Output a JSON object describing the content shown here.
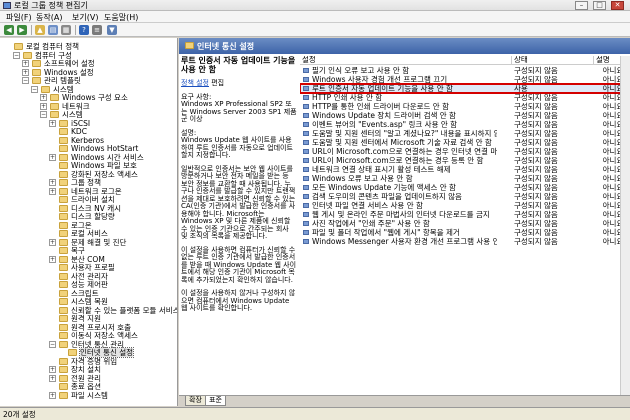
{
  "window": {
    "title": "로컬 그룹 정책 편집기",
    "controls": [
      "–",
      "□",
      "✕"
    ]
  },
  "menu": [
    "파일(F)",
    "동작(A)",
    "보기(V)",
    "도움말(H)"
  ],
  "toolbar": {
    "icons": [
      "back-arrow-icon",
      "forward-arrow-icon",
      "up-folder-icon",
      "show-hide-tree-icon",
      "export-list-icon",
      "help-icon",
      "properties-icon",
      "filter-icon"
    ]
  },
  "tree": [
    {
      "label": "로컬 컴퓨터 정책",
      "level": 0,
      "expander": ""
    },
    {
      "label": "컴퓨터 구성",
      "level": 1,
      "expander": "−"
    },
    {
      "label": "소프트웨어 설정",
      "level": 2,
      "expander": "+"
    },
    {
      "label": "Windows 설정",
      "level": 2,
      "expander": "+"
    },
    {
      "label": "관리 템플릿",
      "level": 2,
      "expander": "−"
    },
    {
      "label": "시스템",
      "level": 3,
      "expander": "−"
    },
    {
      "label": "Windows 구성 요소",
      "level": 4,
      "expander": "+"
    },
    {
      "label": "네트워크",
      "level": 4,
      "expander": "+"
    },
    {
      "label": "시스템",
      "level": 4,
      "expander": "−"
    },
    {
      "label": "iSCSI",
      "level": 5,
      "expander": "+"
    },
    {
      "label": "KDC",
      "level": 5,
      "expander": ""
    },
    {
      "label": "Kerberos",
      "level": 5,
      "expander": ""
    },
    {
      "label": "Windows HotStart",
      "level": 5,
      "expander": ""
    },
    {
      "label": "Windows 시간 서비스",
      "level": 5,
      "expander": "+"
    },
    {
      "label": "Windows 파일 보호",
      "level": 5,
      "expander": ""
    },
    {
      "label": "강화된 저장소 액세스",
      "level": 5,
      "expander": ""
    },
    {
      "label": "그룹 정책",
      "level": 5,
      "expander": "+"
    },
    {
      "label": "네트워크 로그온",
      "level": 5,
      "expander": "+"
    },
    {
      "label": "드라이버 설치",
      "level": 5,
      "expander": ""
    },
    {
      "label": "디스크 NV 캐시",
      "level": 5,
      "expander": ""
    },
    {
      "label": "디스크 할당량",
      "level": 5,
      "expander": ""
    },
    {
      "label": "로그온",
      "level": 5,
      "expander": ""
    },
    {
      "label": "로컬 서비스",
      "level": 5,
      "expander": ""
    },
    {
      "label": "문제 해결 및 진단",
      "level": 5,
      "expander": "+"
    },
    {
      "label": "복구",
      "level": 5,
      "expander": ""
    },
    {
      "label": "분산 COM",
      "level": 5,
      "expander": "+"
    },
    {
      "label": "사용자 프로필",
      "level": 5,
      "expander": ""
    },
    {
      "label": "사전 관리자",
      "level": 5,
      "expander": ""
    },
    {
      "label": "성능 제어판",
      "level": 5,
      "expander": ""
    },
    {
      "label": "스크립트",
      "level": 5,
      "expander": ""
    },
    {
      "label": "시스템 복원",
      "level": 5,
      "expander": ""
    },
    {
      "label": "신뢰할 수 있는 플랫폼 모듈 서비스",
      "level": 5,
      "expander": ""
    },
    {
      "label": "원격 지원",
      "level": 5,
      "expander": ""
    },
    {
      "label": "원격 프로시저 호출",
      "level": 5,
      "expander": ""
    },
    {
      "label": "이동식 저장소 액세스",
      "level": 5,
      "expander": ""
    },
    {
      "label": "인터넷 통신 관리",
      "level": 5,
      "expander": "−"
    },
    {
      "label": "인터넷 통신 설정",
      "level": 6,
      "expander": "",
      "selected": true
    },
    {
      "label": "자격 증명 위임",
      "level": 5,
      "expander": ""
    },
    {
      "label": "장치 설치",
      "level": 5,
      "expander": "+"
    },
    {
      "label": "전원 관리",
      "level": 5,
      "expander": "+"
    },
    {
      "label": "종료 옵션",
      "level": 5,
      "expander": ""
    },
    {
      "label": "파일 시스템",
      "level": 5,
      "expander": "+"
    }
  ],
  "right_header": "인터넷 통신 설정",
  "description": {
    "heading": "루트 인증서 자동 업데이트 기능을 사용 안 함",
    "edit_prefix": "정책 설정",
    "edit_suffix": " 편집",
    "paragraphs": [
      "요구 사항:\nWindows XP Professional SP2 또는 Windows Server 2003 SP1 제품군 이상",
      "설명:\nWindows Update 웹 사이트를 사용하여 루트 인증서를 자동으로 업데이트할지 지정합니다.",
      "일반적으로 인증서는 보안 웹 사이트를 방문하거나 보안 전자 메일을 받는 등 보안 정보를 교환할 때 사용됩니다. 누구나 인증서를 발급할 수 있지만 트랜잭션을 제대로 보호하려면 신뢰할 수 있는 CA(인증 기관)에서 발급한 인증서를 사용해야 합니다. Microsoft는 Windows XP 및 다른 제품에 신뢰할 수 있는 인증 기관으로 간주되는 회사 및 조직의 목록을 제공합니다.",
      "이 설정을 사용하면 컴퓨터가 신뢰할 수 없는 루트 인증 기관에서 발급한 인증서를 받을 때 Windows Update 웹 사이트에서 해당 인증 기관이 Microsoft 목록에 추가되었는지 확인하지 않습니다.",
      "이 설정을 사용하지 않거나 구성하지 않으면 컴퓨터에서 Windows Update 웹 사이트를 확인합니다."
    ]
  },
  "list": {
    "columns": [
      "설정",
      "상태",
      "설명"
    ],
    "rows": [
      {
        "name": "필기 인식 오류 보고 사용 안 함",
        "state": "구성되지 않음",
        "comment": "아니요"
      },
      {
        "name": "Windows 사용자 경험 개선 프로그램 끄기",
        "state": "구성되지 않음",
        "comment": "아니요"
      },
      {
        "name": "루트 인증서 자동 업데이트 기능을 사용 안 함",
        "state": "사용",
        "comment": "아니요",
        "selected": true
      },
      {
        "name": "HTTP 인쇄 사용 안 함",
        "state": "구성되지 않음",
        "comment": "아니요"
      },
      {
        "name": "HTTP를 통한 인쇄 드라이버 다운로드 안 함",
        "state": "구성되지 않음",
        "comment": "아니요"
      },
      {
        "name": "Windows Update 장치 드라이버 검색 안 함",
        "state": "구성되지 않음",
        "comment": "아니요"
      },
      {
        "name": "이벤트 뷰어의 \"Events.asp\" 링크 사용 안 함",
        "state": "구성되지 않음",
        "comment": "아니요"
      },
      {
        "name": "도움말 및 지원 센터의 \"알고 계셨나요?\" 내용을 표시하지 않음",
        "state": "구성되지 않음",
        "comment": "아니요"
      },
      {
        "name": "도움말 및 지원 센터에서 Microsoft 기술 자료 검색 안 함",
        "state": "구성되지 않음",
        "comment": "아니요"
      },
      {
        "name": "URL이 Microsoft.com으로 연결하는 경우 인터넷 연결 마법사 사용 안 함",
        "state": "구성되지 않음",
        "comment": "아니요"
      },
      {
        "name": "URL이 Microsoft.com으로 연결하는 경우 등록 안 함",
        "state": "구성되지 않음",
        "comment": "아니요"
      },
      {
        "name": "네트워크 연결 상태 표시기 활성 테스트 해제",
        "state": "구성되지 않음",
        "comment": "아니요"
      },
      {
        "name": "Windows 오류 보고 사용 안 함",
        "state": "구성되지 않음",
        "comment": "아니요"
      },
      {
        "name": "모든 Windows Update 기능에 액세스 안 함",
        "state": "구성되지 않음",
        "comment": "아니요"
      },
      {
        "name": "검색 도우미의 콘텐츠 파일을 업데이트하지 않음",
        "state": "구성되지 않음",
        "comment": "아니요"
      },
      {
        "name": "인터넷 파일 연결 서비스 사용 안 함",
        "state": "구성되지 않음",
        "comment": "아니요"
      },
      {
        "name": "웹 게시 및 온라인 주문 마법사의 인터넷 다운로드를 금지",
        "state": "구성되지 않음",
        "comment": "아니요"
      },
      {
        "name": "사진 작업에서 \"인쇄 주문\" 사용 안 함",
        "state": "구성되지 않음",
        "comment": "아니요"
      },
      {
        "name": "파일 및 폴더 작업에서 \"웹에 게시\" 항목을 제거",
        "state": "구성되지 않음",
        "comment": "아니요"
      },
      {
        "name": "Windows Messenger 사용자 환경 개선 프로그램 사용 안 함",
        "state": "구성되지 않음",
        "comment": "아니요"
      }
    ]
  },
  "tabs": [
    "확장",
    "표준"
  ],
  "status": "20개 설정",
  "colors": {
    "selection_outline": "#d40000",
    "header_blue": "#3d63a8"
  }
}
